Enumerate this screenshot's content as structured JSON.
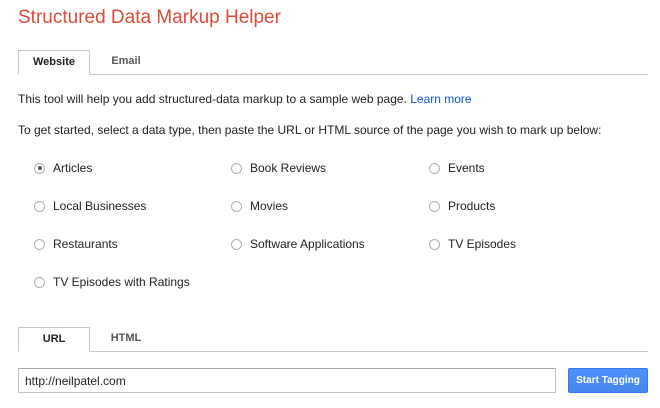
{
  "title": "Structured Data Markup Helper",
  "top_tabs": [
    {
      "label": "Website",
      "active": true
    },
    {
      "label": "Email",
      "active": false
    }
  ],
  "intro": {
    "text": "This tool will help you add structured-data markup to a sample web page. ",
    "link": "Learn more"
  },
  "instruction": "To get started, select a data type, then paste the URL or HTML source of the page you wish to mark up below:",
  "data_types": [
    {
      "label": "Articles",
      "checked": true
    },
    {
      "label": "Book Reviews",
      "checked": false
    },
    {
      "label": "Events",
      "checked": false
    },
    {
      "label": "Local Businesses",
      "checked": false
    },
    {
      "label": "Movies",
      "checked": false
    },
    {
      "label": "Products",
      "checked": false
    },
    {
      "label": "Restaurants",
      "checked": false
    },
    {
      "label": "Software Applications",
      "checked": false
    },
    {
      "label": "TV Episodes",
      "checked": false
    },
    {
      "label": "TV Episodes with Ratings",
      "checked": false
    }
  ],
  "source_tabs": [
    {
      "label": "URL",
      "active": true
    },
    {
      "label": "HTML",
      "active": false
    }
  ],
  "url_input": {
    "value": "http://neilpatel.com"
  },
  "start_button": {
    "label": "Start Tagging"
  },
  "colors": {
    "title": "#dd4b39",
    "link": "#1155cc",
    "button": "#4d90fe"
  }
}
